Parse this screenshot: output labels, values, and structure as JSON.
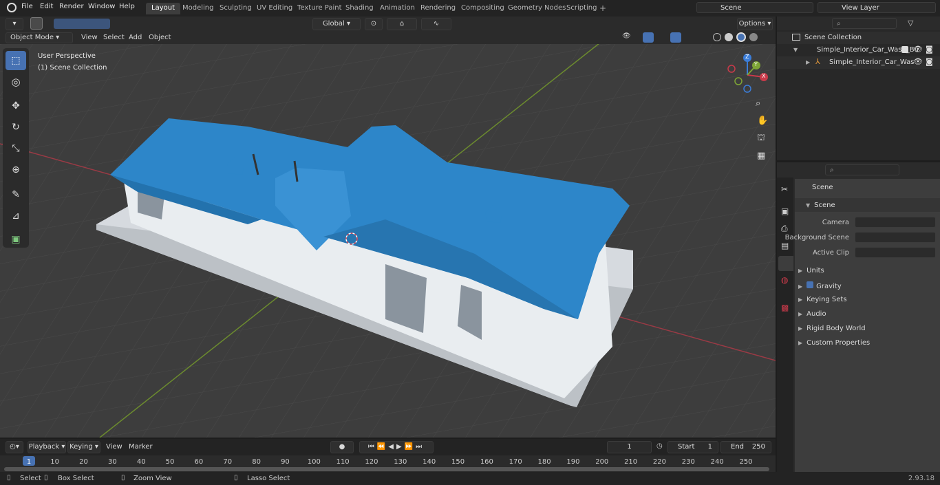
{
  "top_menu": [
    "File",
    "Edit",
    "Render",
    "Window",
    "Help"
  ],
  "workspaces": [
    {
      "label": "Layout",
      "active": true
    },
    {
      "label": "Modeling"
    },
    {
      "label": "Sculpting"
    },
    {
      "label": "UV Editing"
    },
    {
      "label": "Texture Paint"
    },
    {
      "label": "Shading"
    },
    {
      "label": "Animation"
    },
    {
      "label": "Rendering"
    },
    {
      "label": "Compositing"
    },
    {
      "label": "Geometry Nodes"
    },
    {
      "label": "Scripting"
    }
  ],
  "scene_field": "Scene",
  "view_layer_field": "View Layer",
  "viewport_header": {
    "mode": "Object Mode",
    "menus": [
      "View",
      "Select",
      "Add",
      "Object"
    ],
    "orientation": "Global",
    "options": "Options"
  },
  "viewport_overlay": {
    "line1": "User Perspective",
    "line2": "(1) Scene Collection"
  },
  "gizmo": {
    "x": "X",
    "y": "Y",
    "z": "Z"
  },
  "outliner": {
    "root": "Scene Collection",
    "items": [
      "Simple_Interior_Car_Wash_Bu",
      "Simple_Interior_Car_Was"
    ]
  },
  "properties": {
    "title": "Scene",
    "section": "Scene",
    "fields": [
      {
        "label": "Camera"
      },
      {
        "label": "Background Scene"
      },
      {
        "label": "Active Clip"
      }
    ],
    "panels": [
      "Units",
      "Gravity",
      "Keying Sets",
      "Audio",
      "Rigid Body World",
      "Custom Properties"
    ]
  },
  "timeline": {
    "menus": [
      "Playback",
      "Keying",
      "View",
      "Marker"
    ],
    "current_frame": "1",
    "start_label": "Start",
    "start": "1",
    "end_label": "End",
    "end": "250",
    "ticks": [
      "1",
      "10",
      "20",
      "30",
      "40",
      "50",
      "60",
      "70",
      "80",
      "90",
      "100",
      "110",
      "120",
      "130",
      "140",
      "150",
      "160",
      "170",
      "180",
      "190",
      "200",
      "210",
      "220",
      "230",
      "240",
      "250"
    ]
  },
  "statusbar": {
    "select": "Select",
    "box_select": "Box Select",
    "zoom_view": "Zoom View",
    "lasso_select": "Lasso Select",
    "version": "2.93.18"
  },
  "colors": {
    "accent": "#4772b3",
    "roof": "#2d86c9",
    "x_axis": "#c93a4a",
    "y_axis": "#7ea535",
    "z_axis": "#3b7dd8"
  }
}
